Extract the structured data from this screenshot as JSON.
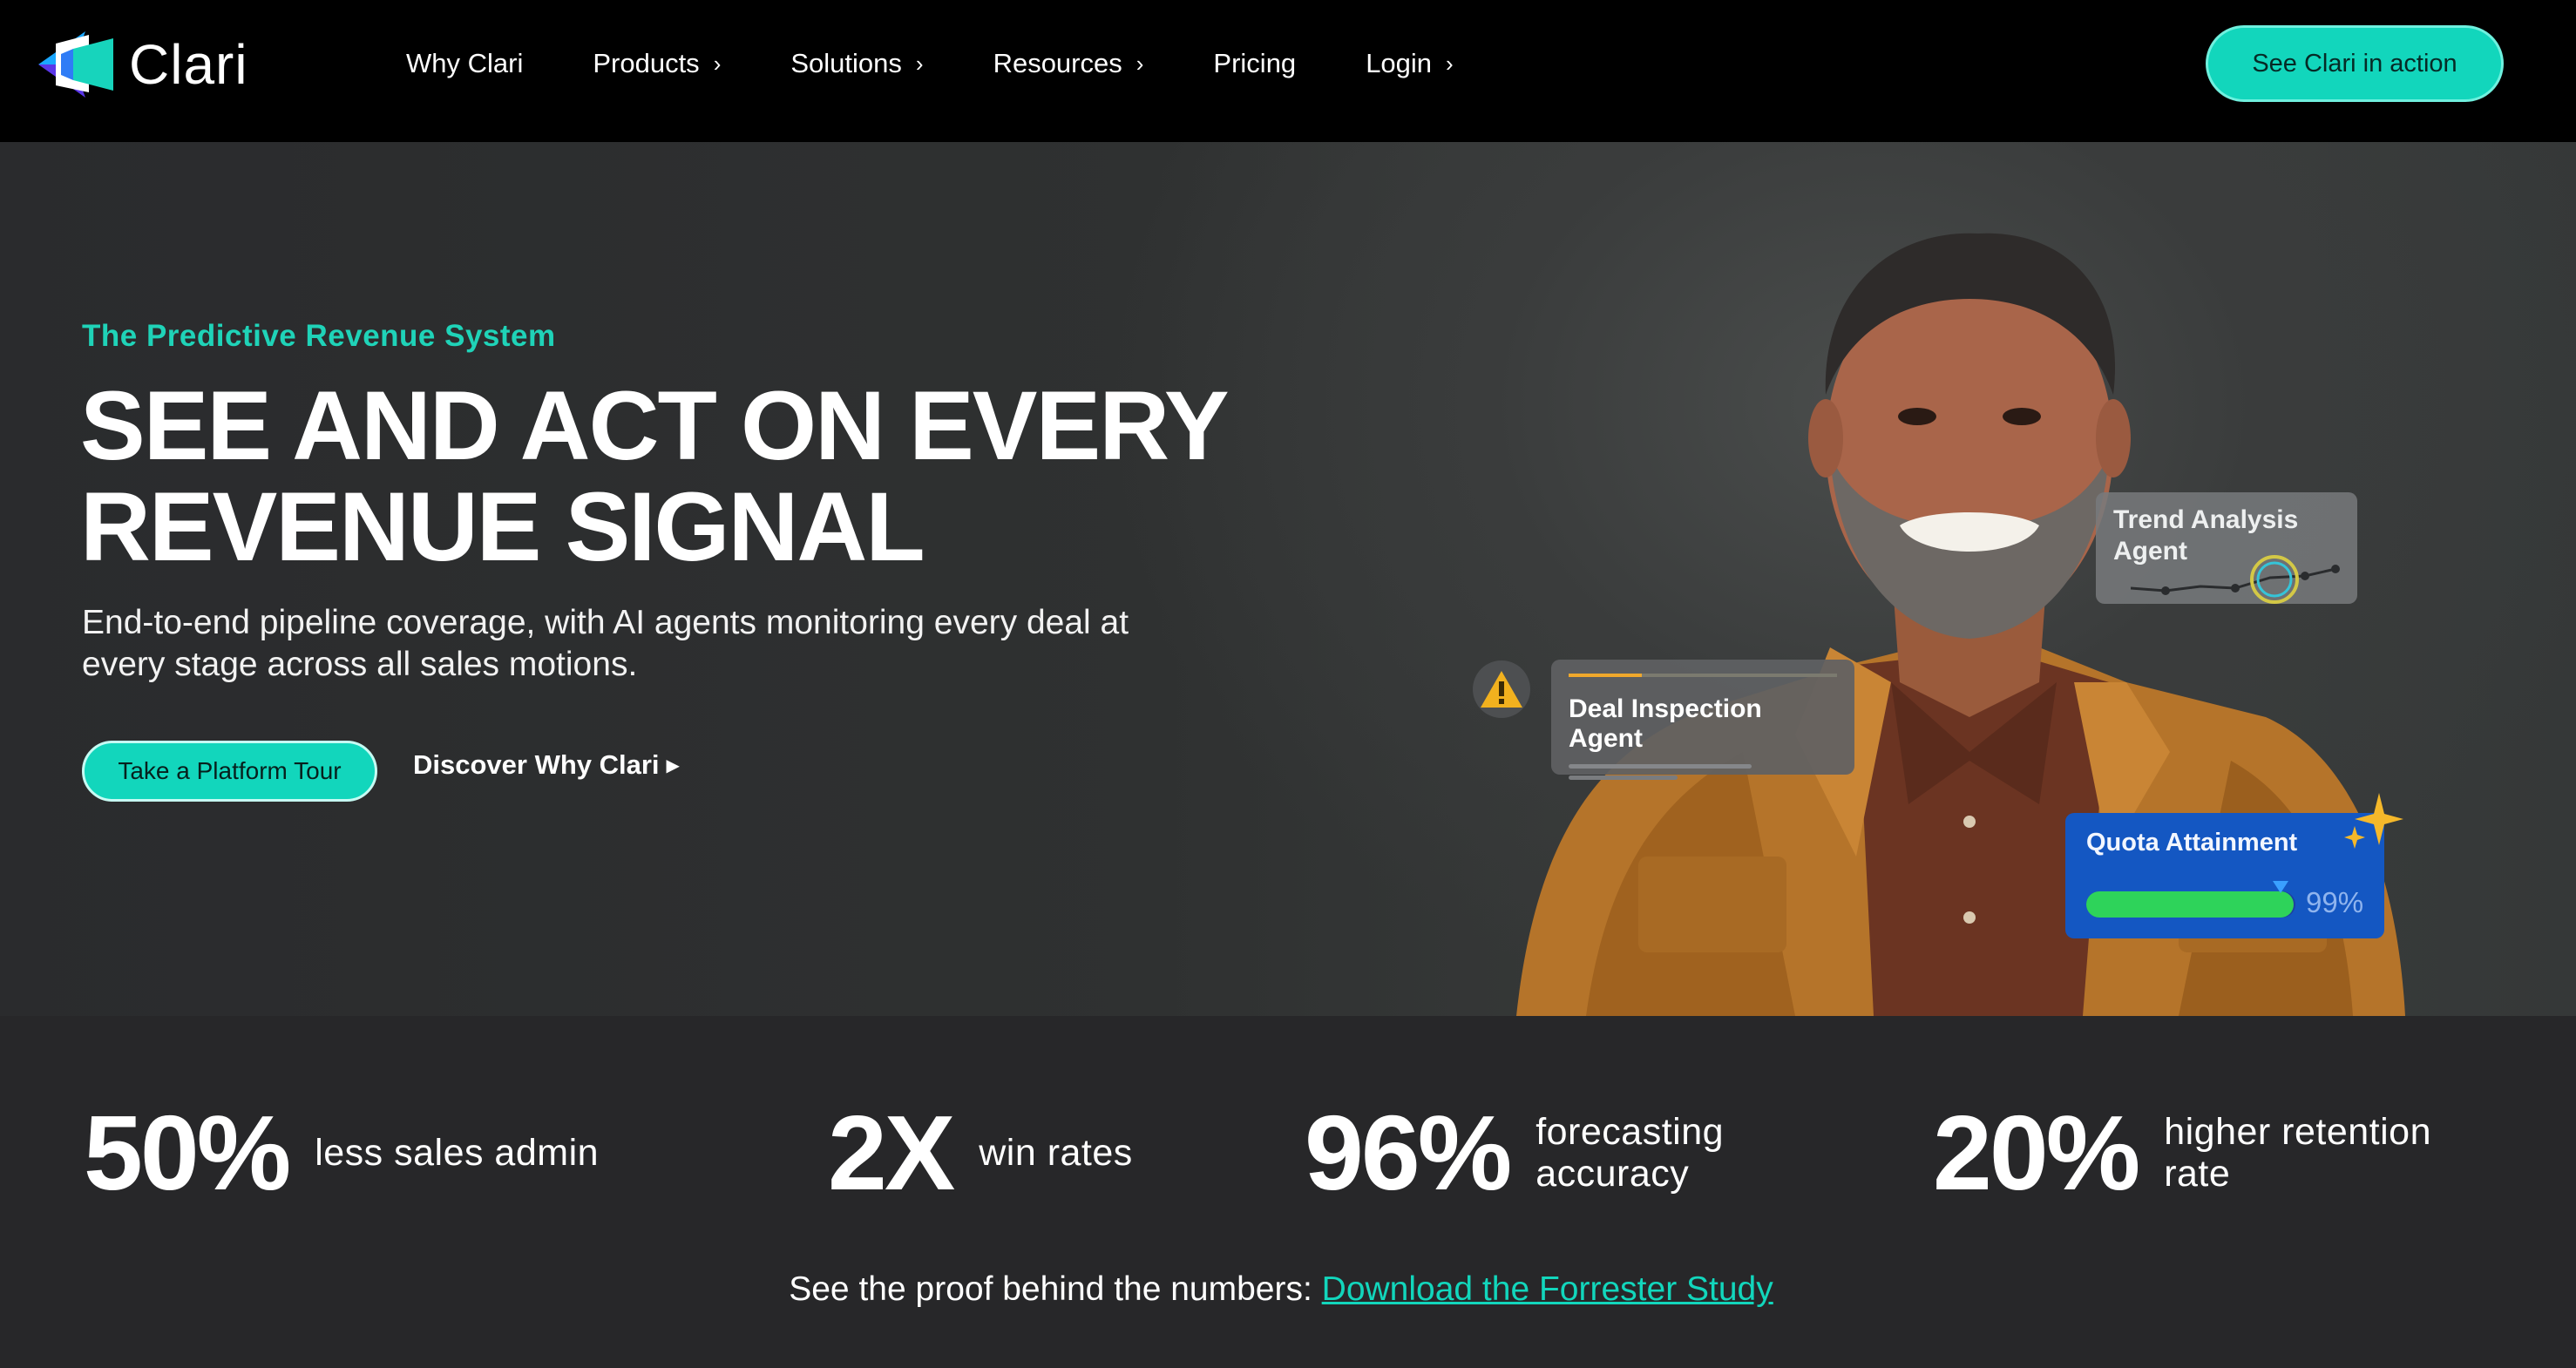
{
  "nav": {
    "logo_text": "Clari",
    "items": [
      {
        "label": "Why Clari",
        "chevron": false
      },
      {
        "label": "Products",
        "chevron": true
      },
      {
        "label": "Solutions",
        "chevron": true
      },
      {
        "label": "Resources",
        "chevron": true
      },
      {
        "label": "Pricing",
        "chevron": false
      },
      {
        "label": "Login",
        "chevron": true
      }
    ],
    "cta_label": "See Clari in action"
  },
  "hero": {
    "eyebrow": "The Predictive Revenue System",
    "headline_line1": "SEE AND ACT ON EVERY",
    "headline_line2": "REVENUE SIGNAL",
    "subtext": "End-to-end pipeline coverage, with AI agents monitoring every deal at every stage across all sales motions.",
    "primary_button": "Take a Platform Tour",
    "secondary_link": "Discover Why Clari",
    "cards": {
      "trend": "Trend Analysis Agent",
      "deal": "Deal Inspection Agent",
      "quota_title": "Quota Attainment",
      "quota_value": "99%",
      "quota_fraction": 0.99
    }
  },
  "stats": [
    {
      "number": "50%",
      "label": "less sales admin"
    },
    {
      "number": "2X",
      "label": "win rates"
    },
    {
      "number": "96%",
      "label": "forecasting accuracy"
    },
    {
      "number": "20%",
      "label": "higher retention rate"
    }
  ],
  "proof": {
    "text": "See the proof behind the numbers:",
    "link": "Download the Forrester Study"
  },
  "colors": {
    "accent": "#12d6bc",
    "quota_blue": "#1457c2",
    "progress_green": "#2ed35a",
    "warning_amber": "#f0a82c"
  },
  "icons": [
    "clari-logo-icon",
    "chevron-right-icon",
    "caret-right-icon",
    "warning-icon",
    "sparkle-icon"
  ]
}
